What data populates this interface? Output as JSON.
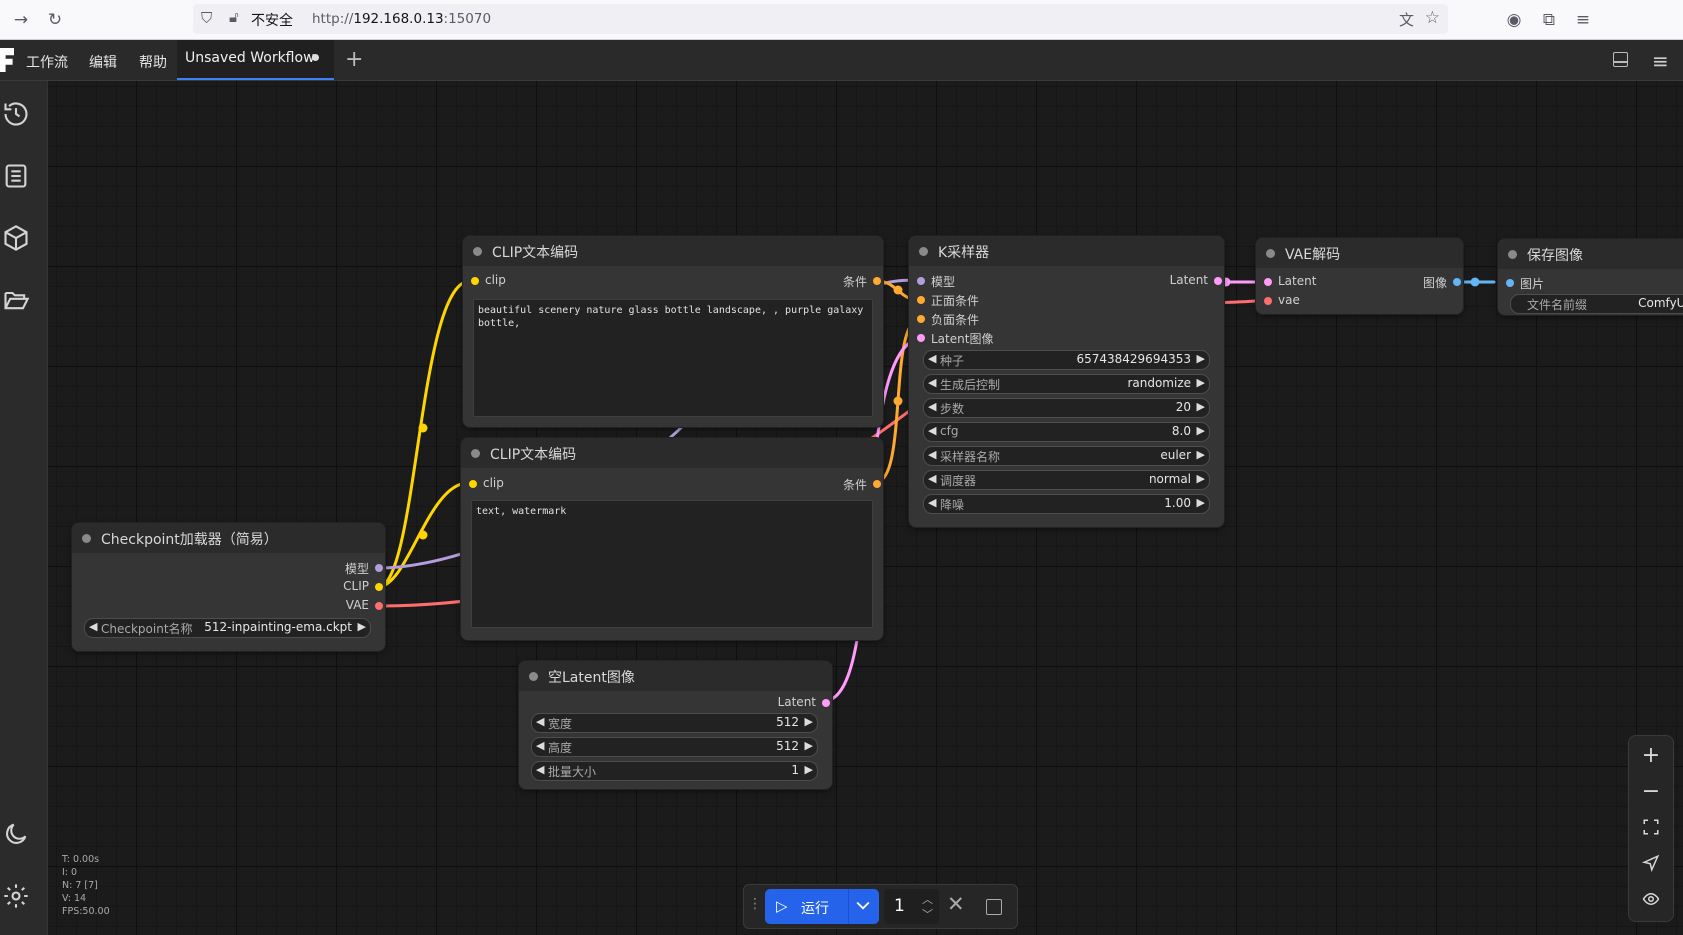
{
  "browser": {
    "insecure_label": "不安全",
    "url_scheme": "http://",
    "url_host": "192.168.0.13",
    "url_port": ":15070"
  },
  "menu": {
    "items": [
      "工作流",
      "编辑",
      "帮助"
    ],
    "tab_title": "Unsaved Workflow"
  },
  "nodes": {
    "clip_pos": {
      "title": "CLIP文本编码",
      "input_clip": "clip",
      "output_cond": "条件",
      "text": "beautiful scenery nature glass bottle landscape, , purple galaxy bottle,"
    },
    "clip_neg": {
      "title": "CLIP文本编码",
      "input_clip": "clip",
      "output_cond": "条件",
      "text": "text, watermark"
    },
    "ksampler": {
      "title": "K采样器",
      "inputs": [
        "模型",
        "正面条件",
        "负面条件",
        "Latent图像"
      ],
      "output_latent": "Latent",
      "widgets": [
        {
          "name": "种子",
          "value": "657438429694353"
        },
        {
          "name": "生成后控制",
          "value": "randomize"
        },
        {
          "name": "步数",
          "value": "20"
        },
        {
          "name": "cfg",
          "value": "8.0"
        },
        {
          "name": "采样器名称",
          "value": "euler"
        },
        {
          "name": "调度器",
          "value": "normal"
        },
        {
          "name": "降噪",
          "value": "1.00"
        }
      ]
    },
    "vae_decode": {
      "title": "VAE解码",
      "input_latent": "Latent",
      "input_vae": "vae",
      "output_image": "图像"
    },
    "save_image": {
      "title": "保存图像",
      "input_images": "图片",
      "widget_name": "文件名前缀",
      "widget_value": "ComfyUI"
    },
    "checkpoint": {
      "title": "Checkpoint加载器（简易）",
      "outputs": [
        "模型",
        "CLIP",
        "VAE"
      ],
      "widget_name": "Checkpoint名称",
      "widget_value": "512-inpainting-ema.ckpt"
    },
    "empty_latent": {
      "title": "空Latent图像",
      "output_latent": "Latent",
      "widgets": [
        {
          "name": "宽度",
          "value": "512"
        },
        {
          "name": "高度",
          "value": "512"
        },
        {
          "name": "批量大小",
          "value": "1"
        }
      ]
    }
  },
  "stats": {
    "t": "T: 0.00s",
    "i": "I: 0",
    "n": "N: 7 [7]",
    "v": "V: 14",
    "fps": "FPS:50.00"
  },
  "runbar": {
    "run_label": "运行",
    "queue_count": "1"
  },
  "colors": {
    "clip": "#ffd500",
    "conditioning": "#ffa931",
    "model": "#b39ddb",
    "vae": "#ff6e6e",
    "latent": "#ff9cf9",
    "image": "#64b5f6",
    "run_button": "#2563eb"
  }
}
